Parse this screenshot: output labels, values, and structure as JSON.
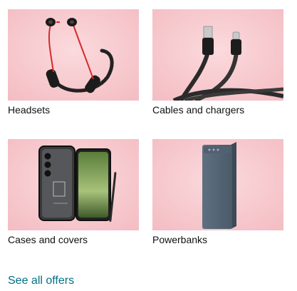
{
  "tiles": [
    {
      "label": "Headsets",
      "icon": "neckband-headset-image"
    },
    {
      "label": "Cables and chargers",
      "icon": "usb-cable-image"
    },
    {
      "label": "Cases and covers",
      "icon": "phone-case-image"
    },
    {
      "label": "Powerbanks",
      "icon": "powerbank-image"
    }
  ],
  "see_all": "See all offers",
  "colors": {
    "tile_bg": "#f6c9cd",
    "link": "#007185",
    "text": "#0f1111"
  }
}
